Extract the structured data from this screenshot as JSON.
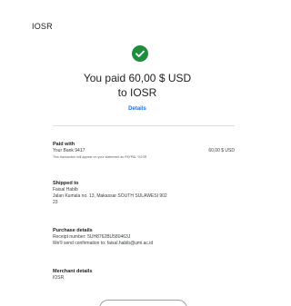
{
  "header": {
    "title": "IOSR"
  },
  "confirmation": {
    "line1": "You paid 60,00 $ USD",
    "line2": "to IOSR",
    "details_link": "Details",
    "success_color": "#1e8e3e"
  },
  "paid_with": {
    "title": "Paid with",
    "method": "Your Bank 9417",
    "amount": "60,00 $ USD",
    "note": "This transaction will appear on your statement as PAYPAL *IOSR"
  },
  "shipped_to": {
    "title": "Shipped to",
    "name": "Faisal Habib",
    "address1": "Jalan Kumala no. 13, Makassar SOUTH SULAWESI 902",
    "address2": "23"
  },
  "purchase_details": {
    "title": "Purchase details",
    "receipt": "Receipt number: 5UH8762BU580463J",
    "confirmation": "We'll send confirmation to: faisal.habib@umi.ac.id"
  },
  "merchant_details": {
    "title": "Merchant details",
    "name": "IOSR"
  }
}
